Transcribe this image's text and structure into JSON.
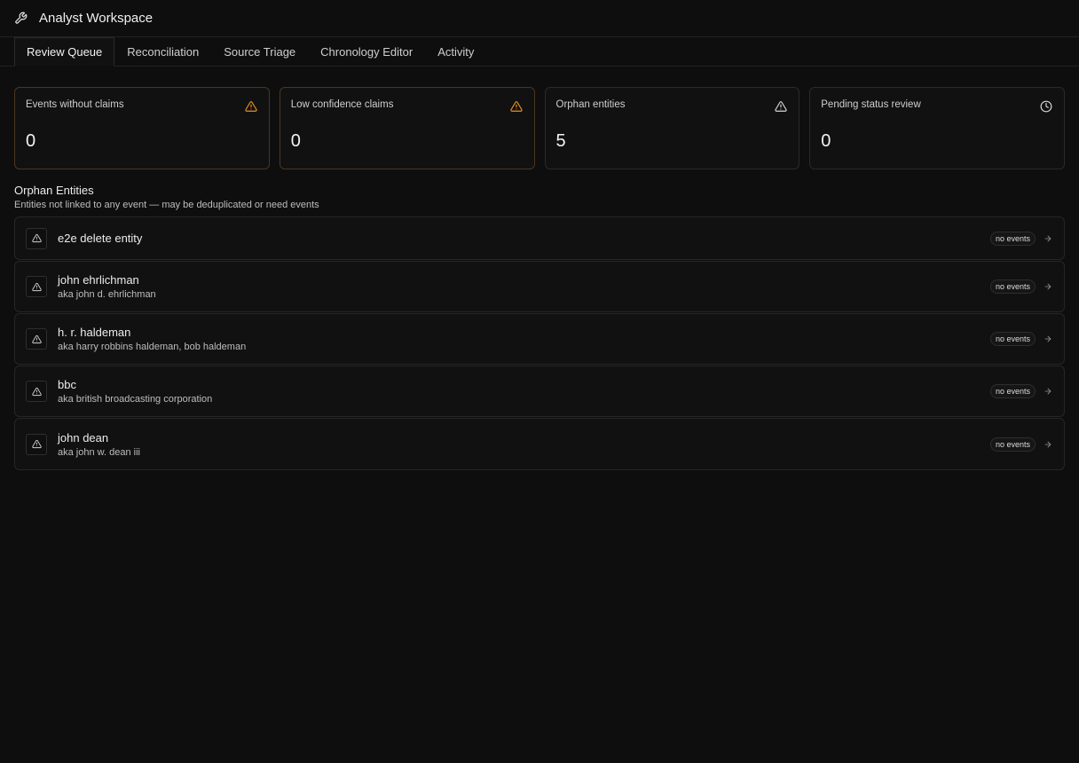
{
  "app": {
    "title": "Analyst Workspace",
    "icon": "wrench-icon"
  },
  "tabs": [
    {
      "label": "Review Queue",
      "active": true
    },
    {
      "label": "Reconciliation",
      "active": false
    },
    {
      "label": "Source Triage",
      "active": false
    },
    {
      "label": "Chronology Editor",
      "active": false
    },
    {
      "label": "Activity",
      "active": false
    }
  ],
  "stats": [
    {
      "label": "Events without claims",
      "value": "0",
      "icon": "warning-icon",
      "icon_color": "#e8902a",
      "warn": true
    },
    {
      "label": "Low confidence claims",
      "value": "0",
      "icon": "warning-icon",
      "icon_color": "#e8902a",
      "warn": true
    },
    {
      "label": "Orphan entities",
      "value": "5",
      "icon": "warning-icon",
      "icon_color": "#d8d8d8",
      "warn": false
    },
    {
      "label": "Pending status review",
      "value": "0",
      "icon": "clock-icon",
      "icon_color": "#d8d8d8",
      "warn": false
    }
  ],
  "section": {
    "title": "Orphan Entities",
    "subtitle": "Entities not linked to any event — may be deduplicated or need events"
  },
  "entities": [
    {
      "name": "e2e delete entity",
      "aka": "",
      "badge": "no events"
    },
    {
      "name": "john ehrlichman",
      "aka": "aka john d. ehrlichman",
      "badge": "no events"
    },
    {
      "name": "h. r. haldeman",
      "aka": "aka harry robbins haldeman, bob haldeman",
      "badge": "no events"
    },
    {
      "name": "bbc",
      "aka": "aka british broadcasting corporation",
      "badge": "no events"
    },
    {
      "name": "john dean",
      "aka": "aka john w. dean iii",
      "badge": "no events"
    }
  ],
  "colors": {
    "background": "#0e0e0e",
    "warning": "#e8902a",
    "border": "#262626"
  }
}
